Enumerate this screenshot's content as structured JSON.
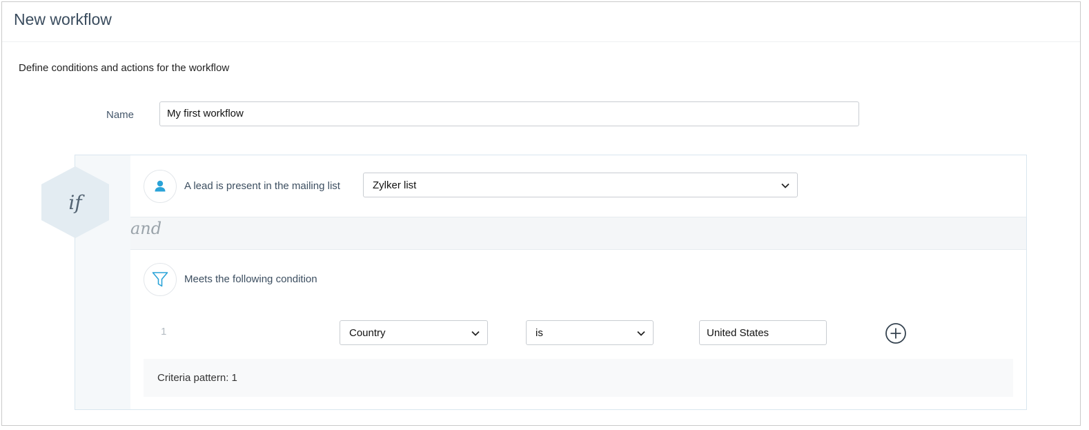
{
  "window": {
    "title": "New workflow"
  },
  "form": {
    "subtitle": "Define conditions and actions for the workflow",
    "name_label": "Name",
    "name_value": "My first workflow"
  },
  "workflow": {
    "if_label": "if",
    "and_label": "and",
    "trigger": {
      "icon": "person-icon",
      "label": "A lead is present in the mailing list",
      "list_value": "Zylker list"
    },
    "condition": {
      "icon": "filter-icon",
      "label": "Meets the following condition",
      "rows": [
        {
          "number": "1",
          "field": "Country",
          "operator": "is",
          "value": "United States"
        }
      ],
      "criteria_pattern": "Criteria pattern: 1"
    }
  },
  "colors": {
    "accent": "#2aa3d8",
    "hexagon": "#e3ecf2",
    "text": "#3c4e60"
  }
}
